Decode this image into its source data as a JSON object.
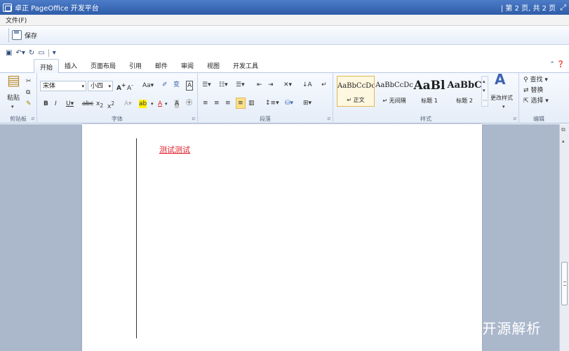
{
  "window": {
    "title": "卓正 PageOffice 开发平台",
    "page_info": "| 第 2 页, 共 2 页"
  },
  "menu": {
    "file": "文件(F)"
  },
  "toolbar": {
    "save_label": "保存"
  },
  "ribbon": {
    "tabs": [
      "开始",
      "插入",
      "页面布局",
      "引用",
      "邮件",
      "审阅",
      "视图",
      "开发工具"
    ],
    "active_tab": "开始",
    "clipboard": {
      "paste_label": "粘贴",
      "group_label": "剪贴板"
    },
    "font": {
      "font_name": "宋体",
      "font_size": "小四",
      "group_label": "字体"
    },
    "paragraph": {
      "group_label": "段落"
    },
    "styles": {
      "items": [
        {
          "sample": "AaBbCcDc",
          "name": "↵ 正文"
        },
        {
          "sample": "AaBbCcDc",
          "name": "↵ 无间隔"
        },
        {
          "sample": "AaBl",
          "name": "标题 1"
        },
        {
          "sample": "AaBbC",
          "name": "标题 2"
        }
      ],
      "change_styles": "更改样式",
      "group_label": "样式"
    },
    "editing": {
      "find": "查找",
      "replace": "替换",
      "select": "选择",
      "group_label": "编辑"
    }
  },
  "document": {
    "text": "测试测试"
  },
  "watermark": "知乎 @开源解析"
}
